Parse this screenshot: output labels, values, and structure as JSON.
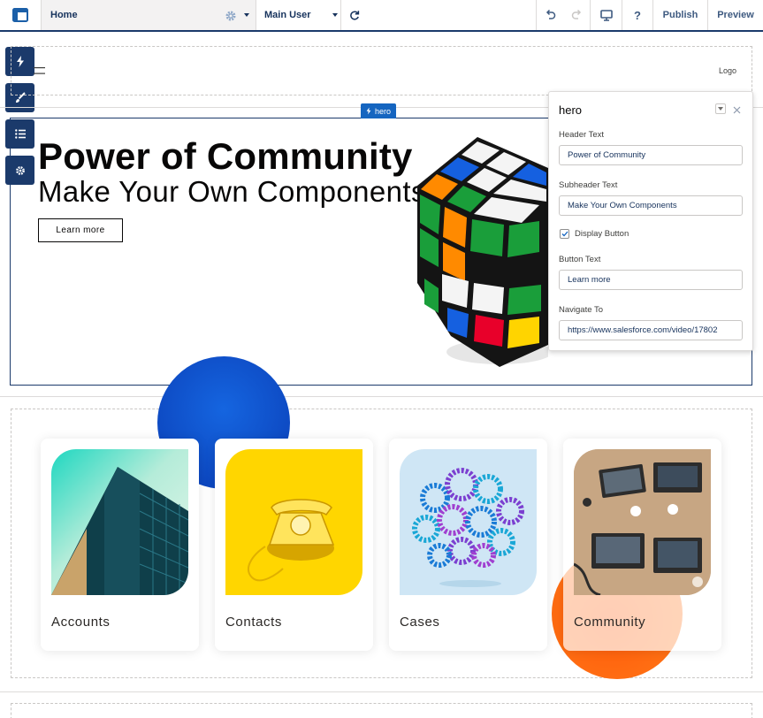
{
  "toolbar": {
    "page_name": "Home",
    "user_name": "Main User",
    "publish_label": "Publish",
    "preview_label": "Preview",
    "help_label": "?"
  },
  "header": {
    "logo_text": "Logo"
  },
  "hero": {
    "tag_label": "hero",
    "title": "Power of Community",
    "subtitle": "Make Your Own Components",
    "button_label": "Learn more"
  },
  "panel": {
    "title": "hero",
    "header_text_label": "Header Text",
    "header_text_value": "Power of Community",
    "subheader_text_label": "Subheader Text",
    "subheader_text_value": "Make Your Own Components",
    "display_button_label": "Display Button",
    "display_button_checked": true,
    "button_text_label": "Button Text",
    "button_text_value": "Learn more",
    "navigate_to_label": "Navigate To",
    "navigate_to_value": "https://www.salesforce.com/video/17802"
  },
  "cards": [
    {
      "label": "Accounts",
      "image": "office-building-photo"
    },
    {
      "label": "Contacts",
      "image": "yellow-telephone-photo"
    },
    {
      "label": "Cases",
      "image": "gears-brain-photo"
    },
    {
      "label": "Community",
      "image": "team-laptops-photo"
    }
  ],
  "colors": {
    "dock": "#1b3a6b",
    "accent_blue": "#1565c0",
    "orange": "#ff6a12"
  }
}
